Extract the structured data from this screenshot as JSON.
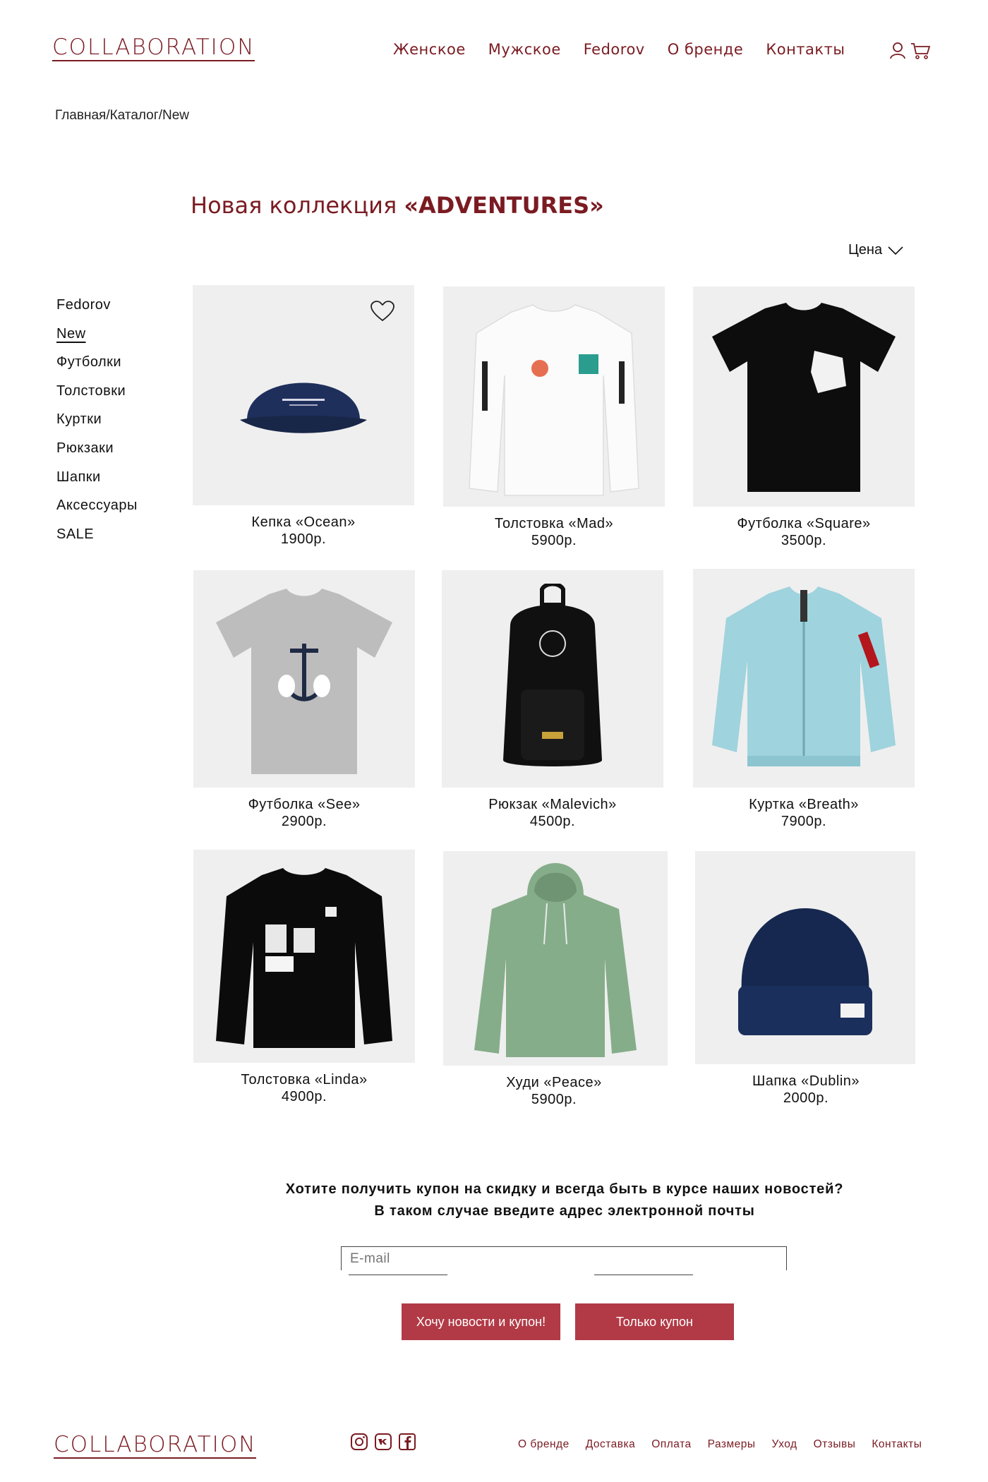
{
  "header": {
    "logo": "COLLABORATION",
    "nav": [
      "Женское",
      "Мужское",
      "Fedorov",
      "О бренде",
      "Контакты"
    ]
  },
  "breadcrumb": {
    "home": "Главная",
    "sep1": "/",
    "catalog": "Каталог",
    "sep2": "/",
    "current": "New"
  },
  "title": {
    "prefix": "Новая коллекция ",
    "name": "«ADVENTURES»"
  },
  "sort": {
    "label": "Цена"
  },
  "sidebar": {
    "items": [
      "Fedorov",
      "New",
      "Футболки",
      "Толстовки",
      "Куртки",
      "Рюкзаки",
      "Шапки",
      "Аксессуары",
      "SALE"
    ],
    "active": "New"
  },
  "products": [
    {
      "name": "Кепка «Ocean»",
      "price": "1900р."
    },
    {
      "name": "Толстовка «Mad»",
      "price": "5900р."
    },
    {
      "name": "Футболка «Square»",
      "price": "3500р."
    },
    {
      "name": "Футболка «See»",
      "price": "2900р."
    },
    {
      "name": "Рюкзак «Malevich»",
      "price": "4500р."
    },
    {
      "name": "Куртка «Breath»",
      "price": "7900р."
    },
    {
      "name": "Толстовка «Linda»",
      "price": "4900р."
    },
    {
      "name": "Худи «Peace»",
      "price": "5900р."
    },
    {
      "name": "Шапка «Dublin»",
      "price": "2000р."
    }
  ],
  "newsletter": {
    "line1": "Хотите получить купон на скидку и всегда быть в курсе наших новостей?",
    "line2": "В таком случае введите адрес электронной почты",
    "email_placeholder": "E-mail",
    "btn_news": "Хочу новости и купон!",
    "btn_coupon": "Только купон"
  },
  "footer": {
    "logo": "COLLABORATION",
    "links": [
      "О бренде",
      "Доставка",
      "Оплата",
      "Размеры",
      "Уход",
      "Отзывы",
      "Контакты"
    ],
    "social": [
      "instagram-icon",
      "vk-icon",
      "facebook-icon"
    ]
  },
  "colors": {
    "brand": "#7a1b22",
    "button": "#b13a46",
    "tile": "#efefef"
  }
}
